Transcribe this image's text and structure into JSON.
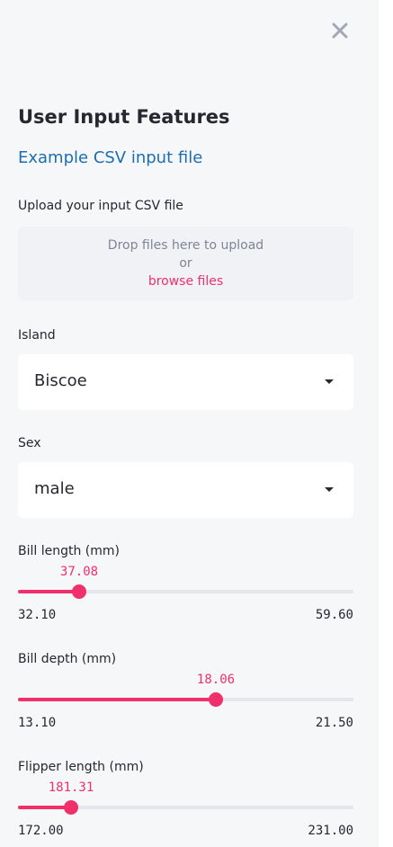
{
  "sidebar": {
    "close_icon": "close-icon",
    "title": "User Input Features",
    "example_link": "Example CSV input file",
    "upload": {
      "label": "Upload your input CSV file",
      "drop_text": "Drop files here to upload",
      "or_text": "or",
      "browse_text": "browse files"
    },
    "island": {
      "label": "Island",
      "value": "Biscoe"
    },
    "sex": {
      "label": "Sex",
      "value": "male"
    },
    "sliders": [
      {
        "label": "Bill length (mm)",
        "value": "37.08",
        "min": "32.10",
        "max": "59.60",
        "fraction": 0.181
      },
      {
        "label": "Bill depth (mm)",
        "value": "18.06",
        "min": "13.10",
        "max": "21.50",
        "fraction": 0.59
      },
      {
        "label": "Flipper length (mm)",
        "value": "181.31",
        "min": "172.00",
        "max": "231.00",
        "fraction": 0.158
      }
    ]
  },
  "colors": {
    "accent": "#f0306a",
    "link": "#1c6eb0",
    "sidebar_bg": "#f6f7f9",
    "text": "#262730"
  }
}
